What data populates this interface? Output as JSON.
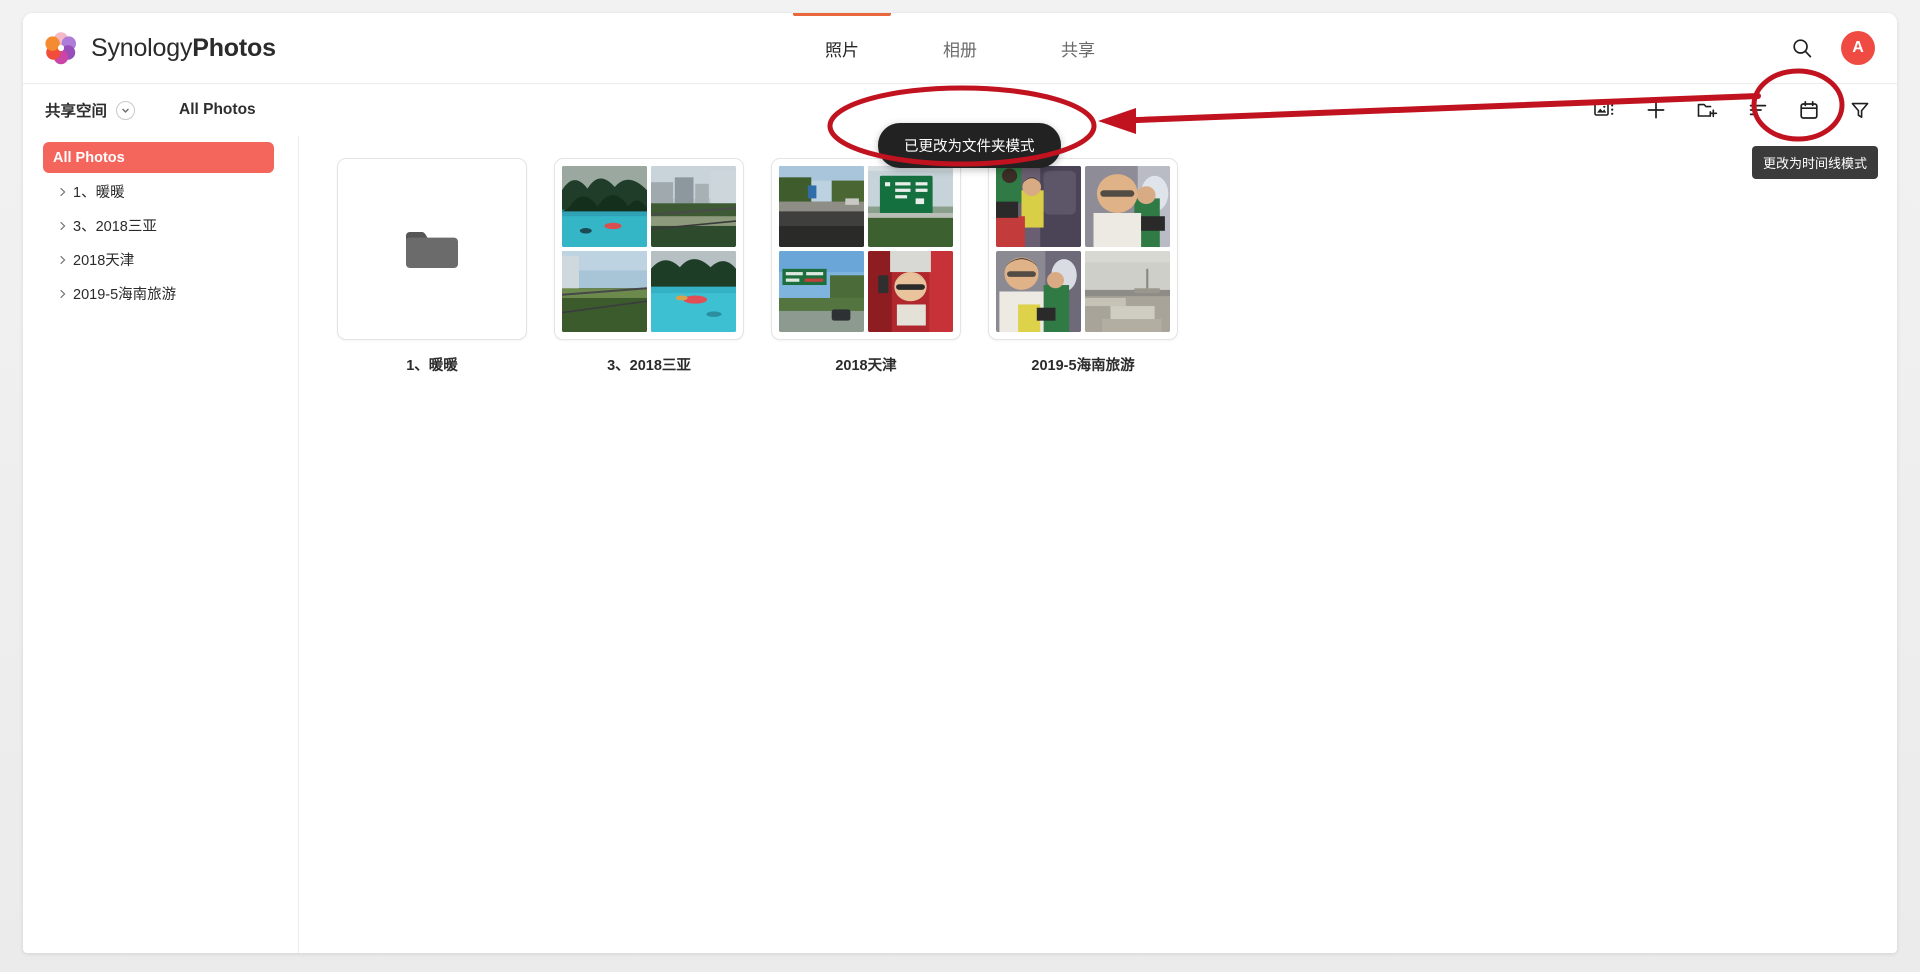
{
  "app": {
    "brand_light": "Synology",
    "brand_bold": "Photos",
    "logo_icon": "synology-photos-flower-logo"
  },
  "header": {
    "tabs": [
      {
        "label": "照片",
        "active": true
      },
      {
        "label": "相册",
        "active": false
      },
      {
        "label": "共享",
        "active": false
      }
    ],
    "search_icon": "search-icon",
    "avatar_initial": "A",
    "avatar_color": "#f04b42",
    "active_tab_indicator_color": "#e8673c"
  },
  "subbar": {
    "space_label": "共享空间",
    "space_caret_icon": "chevron-down-icon",
    "breadcrumb": "All Photos",
    "tools": [
      {
        "name": "gallery-view-icon",
        "label": "图库视图"
      },
      {
        "name": "plus-icon",
        "label": "添加"
      },
      {
        "name": "new-folder-icon",
        "label": "新建文件夹"
      },
      {
        "name": "sort-icon",
        "label": "排序"
      },
      {
        "name": "calendar-icon",
        "label": "更改为时间线模式",
        "highlighted": true
      },
      {
        "name": "filter-icon",
        "label": "筛选"
      }
    ]
  },
  "sidebar": {
    "selected": "All Photos",
    "items": [
      {
        "label": "All Photos",
        "selected": true,
        "expandable": false
      },
      {
        "label": "1、暖暖",
        "selected": false,
        "expandable": true
      },
      {
        "label": "3、2018三亚",
        "selected": false,
        "expandable": true
      },
      {
        "label": "2018天津",
        "selected": false,
        "expandable": true
      },
      {
        "label": "2019-5海南旅游",
        "selected": false,
        "expandable": true
      }
    ],
    "selected_bg": "#f4655c"
  },
  "content": {
    "folders": [
      {
        "title": "1、暖暖",
        "empty": true,
        "empty_icon": "folder-icon",
        "thumbs": []
      },
      {
        "title": "3、2018三亚",
        "empty": false,
        "thumbs": [
          "resort-pool-with-palm-trees",
          "seaside-buildings-and-walkway",
          "beach-railing-with-hedge",
          "swimming-pool-with-floats"
        ]
      },
      {
        "title": "2018天津",
        "empty": false,
        "thumbs": [
          "highway-road-from-car",
          "green-road-sign-overhead",
          "road-sign-and-blue-sky",
          "child-in-red-car-seat"
        ]
      },
      {
        "title": "2019-5海南旅游",
        "empty": false,
        "thumbs": [
          "family-in-airplane-cabin",
          "man-with-glasses-on-plane",
          "man-and-child-on-plane",
          "airport-tarmac-view"
        ]
      }
    ]
  },
  "toast": {
    "message": "已更改为文件夹模式"
  },
  "tooltip": {
    "message": "更改为时间线模式"
  },
  "annotations": {
    "color": "#c1121f",
    "ellipse_around_toast": true,
    "ellipse_around_calendar_button": true,
    "arrow_pointing_left": true
  }
}
